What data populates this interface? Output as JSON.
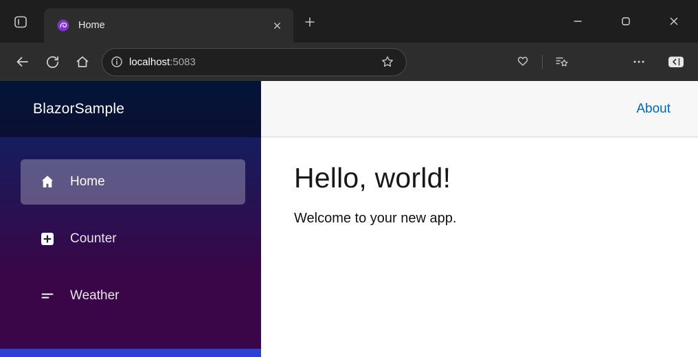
{
  "browser": {
    "titlebar": {
      "tab_title": "Home"
    },
    "toolbar": {
      "url_host": "localhost",
      "url_port": ":5083"
    }
  },
  "app": {
    "brand": "BlazorSample",
    "topbar": {
      "about_label": "About"
    },
    "nav": {
      "items": [
        {
          "label": "Home",
          "icon": "house-icon",
          "active": true
        },
        {
          "label": "Counter",
          "icon": "plus-square-icon",
          "active": false
        },
        {
          "label": "Weather",
          "icon": "list-icon",
          "active": false
        }
      ]
    },
    "content": {
      "heading": "Hello, world!",
      "welcome": "Welcome to your new app."
    }
  },
  "icons": [
    "tab-actions-icon",
    "blazor-favicon-icon",
    "tab-close-icon",
    "new-tab-icon",
    "minimize-icon",
    "maximize-icon",
    "close-icon",
    "back-icon",
    "reload-icon",
    "home-icon",
    "info-icon",
    "star-icon",
    "browser-essentials-icon",
    "favorites-icon",
    "more-icon",
    "sidebar-toggle-icon",
    "house-icon",
    "plus-square-icon",
    "list-icon"
  ],
  "colors": {
    "titlebar_bg": "#1e1e1e",
    "toolbar_bg": "#2d2d2d",
    "accent_link": "#0068b5",
    "sidebar_gradient_top": "#052767",
    "sidebar_gradient_bottom": "#3a0647",
    "active_nav_highlight": "rgba(255,255,255,0.28)",
    "bottom_strip": "#2c41d4",
    "favicon_purple": "#7d35c6"
  }
}
